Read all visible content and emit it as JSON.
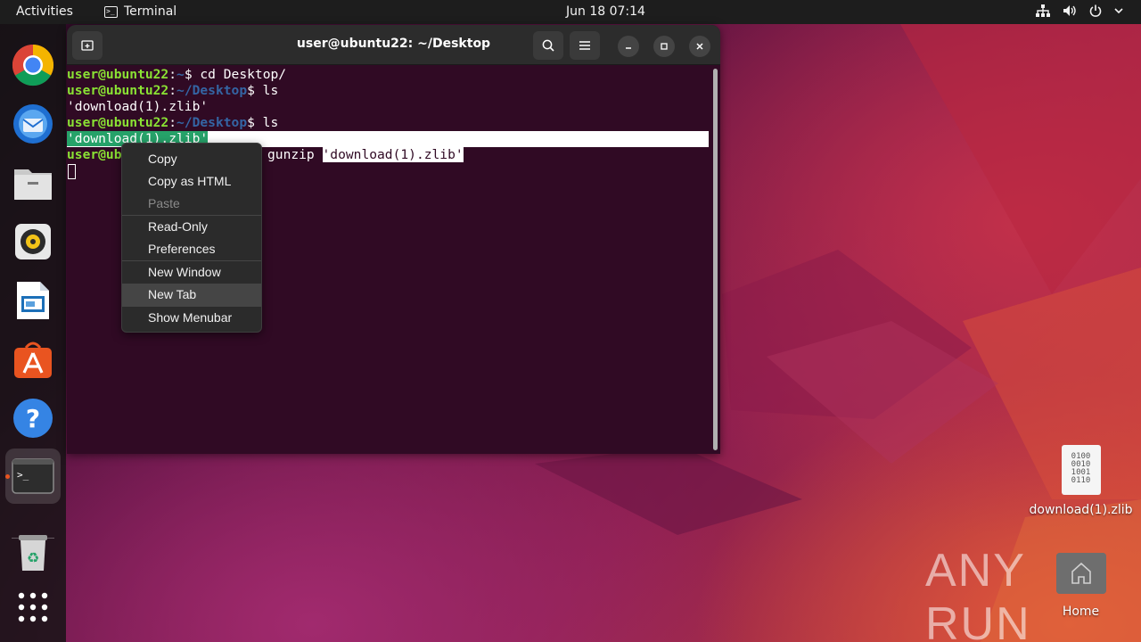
{
  "topbar": {
    "activities": "Activities",
    "app_name": "Terminal",
    "clock": "Jun 18  07:14"
  },
  "dock": {
    "items": [
      "Google Chrome",
      "Thunderbird Mail",
      "Files",
      "Rhythmbox",
      "LibreOffice Impress",
      "Ubuntu Software",
      "Help",
      "Terminal",
      "Trash",
      "Show Applications"
    ]
  },
  "terminal": {
    "title": "user@ubuntu22: ~/Desktop",
    "lines": [
      {
        "user": "user@ubuntu22",
        "path": "~",
        "cmd": "$ cd Desktop/"
      },
      {
        "user": "user@ubuntu22",
        "path": "~/Desktop",
        "cmd": "$ ls"
      },
      {
        "output": "'download(1).zlib'"
      },
      {
        "user": "user@ubuntu22",
        "path": "~/Desktop",
        "cmd": "$ ls"
      },
      {
        "output_selected": "'download(1).zlib'"
      },
      {
        "user_partial": "user@ubu",
        "cmd_tail": "gunzip ",
        "arg_selected": "'download(1).zlib'"
      }
    ]
  },
  "context_menu": {
    "items": [
      "Copy",
      "Copy as HTML",
      "Paste",
      "Read-Only",
      "Preferences",
      "New Window",
      "New Tab",
      "Show Menubar"
    ]
  },
  "desktop": {
    "file_label": "download(1).zlib",
    "file_glyph": "0100\n0010\n1001\n0110",
    "home_label": "Home",
    "watermark": "ANY RUN"
  },
  "colors": {
    "terminal_bg": "#300a24",
    "prompt_user": "#8ae234",
    "prompt_path": "#3465a4",
    "accent": "#e95420"
  }
}
